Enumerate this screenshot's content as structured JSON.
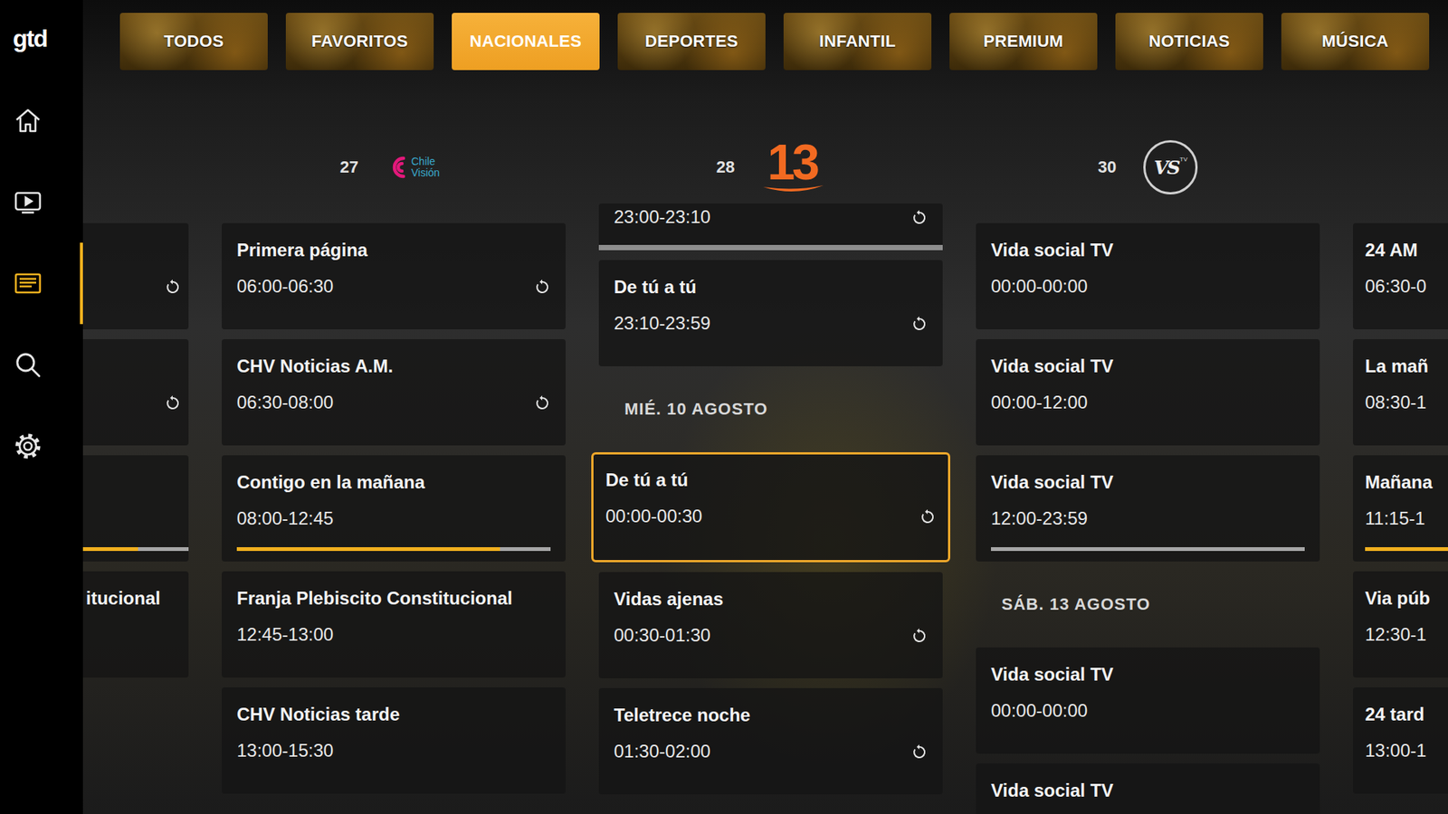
{
  "sidebar": {
    "logo": "gtd",
    "items": [
      {
        "kind": "home",
        "selected": false
      },
      {
        "kind": "live",
        "selected": false
      },
      {
        "kind": "guide",
        "selected": true
      },
      {
        "kind": "search",
        "selected": false
      },
      {
        "kind": "settings",
        "selected": false
      }
    ]
  },
  "tabs": [
    {
      "label": "TODOS",
      "selected": false
    },
    {
      "label": "FAVORITOS",
      "selected": false
    },
    {
      "label": "NACIONALES",
      "selected": true
    },
    {
      "label": "DEPORTES",
      "selected": false
    },
    {
      "label": "INFANTIL",
      "selected": false
    },
    {
      "label": "PREMIUM",
      "selected": false
    },
    {
      "label": "NOTICIAS",
      "selected": false
    },
    {
      "label": "MÚSICA",
      "selected": false
    }
  ],
  "guide": {
    "left_edge": {
      "entries": [
        {
          "kind": "program",
          "catchup": true,
          "selected": false
        },
        {
          "kind": "program",
          "catchup": true,
          "selected": false
        },
        {
          "kind": "program",
          "catchup": false,
          "selected": false,
          "level": 0.52
        },
        {
          "kind": "program",
          "title": "itucional",
          "catchup": false,
          "selected": false
        }
      ]
    },
    "channels": [
      {
        "number": "27",
        "logo": {
          "kind": "swirl",
          "text": "Chile Visión"
        },
        "entries": [
          {
            "kind": "program",
            "title": "Primera página",
            "time": "06:00-06:30",
            "catchup": true,
            "selected": false
          },
          {
            "kind": "program",
            "title": "CHV Noticias A.M.",
            "time": "06:30-08:00",
            "catchup": true,
            "selected": false
          },
          {
            "kind": "program",
            "title": "Contigo en la mañana",
            "time": "08:00-12:45",
            "catchup": false,
            "selected": false,
            "level": 0.84
          },
          {
            "kind": "program",
            "title": "Franja Plebiscito Constitucional",
            "time": "12:45-13:00",
            "catchup": false,
            "selected": false
          },
          {
            "kind": "program",
            "title": "CHV Noticias tarde",
            "time": "13:00-15:30",
            "catchup": false,
            "selected": false
          }
        ]
      },
      {
        "number": "28",
        "logo": {
          "kind": "numeral",
          "text": "13"
        },
        "entries": [
          {
            "kind": "clipped",
            "time": "23:00-23:10",
            "catchup": true,
            "selected": false,
            "level": 0
          },
          {
            "kind": "program",
            "title": "De tú a tú",
            "time": "23:10-23:59",
            "catchup": true,
            "selected": false
          },
          {
            "kind": "date",
            "label": "MIÉ. 10 AGOSTO"
          },
          {
            "kind": "program",
            "title": "De tú a tú",
            "time": "00:00-00:30",
            "catchup": true,
            "selected": true
          },
          {
            "kind": "program",
            "title": "Vidas ajenas",
            "time": "00:30-01:30",
            "catchup": true,
            "selected": false
          },
          {
            "kind": "program",
            "title": "Teletrece noche",
            "time": "01:30-02:00",
            "catchup": true,
            "selected": false
          }
        ]
      },
      {
        "number": "30",
        "logo": {
          "kind": "circle",
          "text": "VS",
          "sub": "TV"
        },
        "entries": [
          {
            "kind": "program",
            "title": "Vida social TV",
            "time": "00:00-00:00",
            "catchup": false,
            "selected": false
          },
          {
            "kind": "program",
            "title": "Vida social TV",
            "time": "00:00-12:00",
            "catchup": false,
            "selected": false
          },
          {
            "kind": "program",
            "title": "Vida social TV",
            "time": "12:00-23:59",
            "catchup": false,
            "selected": false,
            "level": 0
          },
          {
            "kind": "date",
            "label": "SÁB. 13 AGOSTO"
          },
          {
            "kind": "program",
            "title": "Vida social TV",
            "time": "00:00-00:00",
            "catchup": false,
            "selected": false
          },
          {
            "kind": "program",
            "title": "Vida social TV",
            "catchup": false,
            "selected": false
          }
        ]
      }
    ],
    "right_edge": {
      "entries": [
        {
          "kind": "program",
          "title": "24 AM",
          "time": "06:30-0",
          "catchup": false,
          "selected": false
        },
        {
          "kind": "program",
          "title": "La mañ",
          "time": "08:30-1",
          "catchup": false,
          "selected": false
        },
        {
          "kind": "program",
          "title": "Mañana",
          "time": "11:15-1",
          "catchup": false,
          "selected": false,
          "level": 1
        },
        {
          "kind": "program",
          "title": "Via púb",
          "time": "12:30-1",
          "catchup": false,
          "selected": false
        },
        {
          "kind": "program",
          "title": "24 tard",
          "time": "13:00-1",
          "catchup": false,
          "selected": false
        }
      ]
    }
  }
}
